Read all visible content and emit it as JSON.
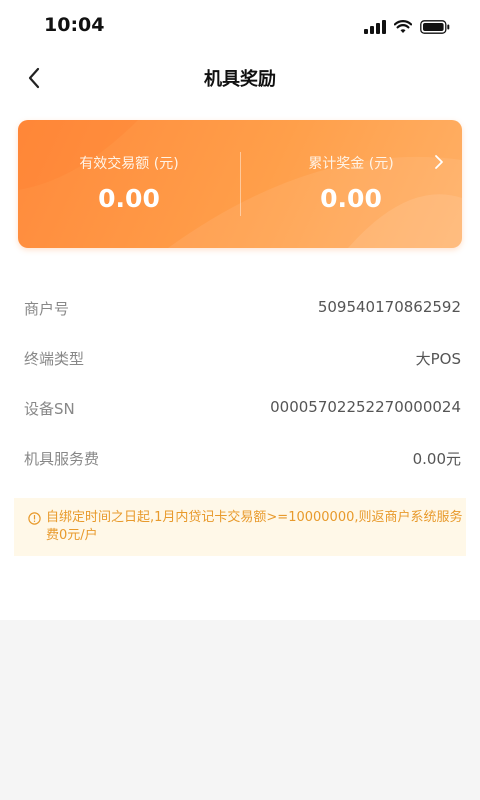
{
  "status_bar": {
    "time": "10:04"
  },
  "nav": {
    "title": "机具奖励",
    "back_icon": "chevron-left-icon"
  },
  "reward_card": {
    "valid_amount_label": "有效交易额 (元)",
    "valid_amount_value": "0.00",
    "total_reward_label": "累计奖金 (元)",
    "total_reward_value": "0.00",
    "arrow_icon": "chevron-right-icon",
    "colors": {
      "start": "#ff8a3c",
      "end": "#ffb066"
    }
  },
  "info": {
    "rows": [
      {
        "label": "商户号",
        "value": "509540170862592"
      },
      {
        "label": "终端类型",
        "value": "大POS"
      },
      {
        "label": "设备SN",
        "value": "00005702252270000024"
      },
      {
        "label": "机具服务费",
        "value": "0.00元"
      }
    ]
  },
  "notice": {
    "icon": "info-circle-icon",
    "text": "自绑定时间之日起,1月内贷记卡交易额>=10000000,则返商户系统服务费0元/户",
    "color": "#e89a2c"
  }
}
